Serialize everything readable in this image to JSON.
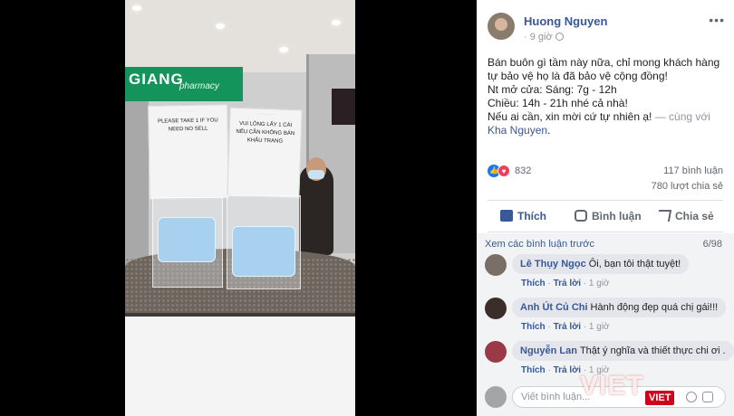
{
  "post": {
    "author": "Huong Nguyen",
    "time": "9 giờ",
    "more_icon": "more-dots-icon",
    "text_line1": "Bán buôn gì tầm này nữa, chỉ mong khách hàng tự bảo vệ họ là đã bảo vệ cộng đồng!",
    "text_line2": "Nt mở cửa: Sáng: 7g - 12h",
    "text_line3": "Chiều: 14h - 21h nhé cả nhà!",
    "text_line4": "Nếu ai cần, xin mời cứ tự nhiên ạ!",
    "with_text": " — cùng với ",
    "tagged": "Kha Nguyen",
    "tagged_end": "."
  },
  "photo": {
    "store_sign": "GIANG",
    "store_sign_sub": "pharmacy",
    "paper1_title": "PLEASE TAKE 1 IF YOU NEED NO SELL",
    "paper2_title": "VUI LÒNG LẤY 1 CÁI NẾU CẦN KHÔNG BÁN KHẨU TRANG"
  },
  "stats": {
    "reactions_count": "832",
    "comments": "117 bình luận",
    "shares": "780 lượt chia sẻ"
  },
  "actions": {
    "like": "Thích",
    "comment": "Bình luận",
    "share": "Chia sẻ"
  },
  "comments_section": {
    "view_previous": "Xem các bình luận trước",
    "count": "6/98",
    "items": [
      {
        "name": "Lê Thụy Ngọc",
        "text": "Ôi, bạn tôi thật tuyệt!",
        "like": "Thích",
        "reply": "Trả lời",
        "time": "1 giờ"
      },
      {
        "name": "Anh Út Củ Chi",
        "text": "Hành động đẹp quá chị gái!!!",
        "like": "Thích",
        "reply": "Trả lời",
        "time": "1 giờ"
      },
      {
        "name": "Nguyễn Lan",
        "text": "Thật ý nghĩa và thiết thực chi ơi .",
        "like": "Thích",
        "reply": "Trả lời",
        "time": "1 giờ"
      }
    ],
    "placeholder": "Viết bình luận..."
  },
  "watermark": {
    "text": "VIET",
    "badge": "VIET"
  },
  "colors": {
    "link": "#385898",
    "like_blue": "#1877f2",
    "love_red": "#f33e58",
    "sign_green": "#14935a",
    "watermark_red": "#d0021b"
  }
}
